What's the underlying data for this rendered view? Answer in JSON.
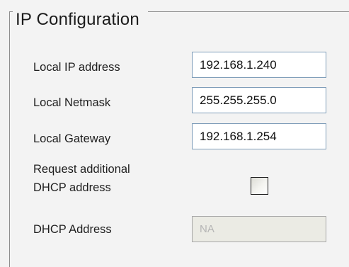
{
  "ip_configuration": {
    "title": "IP Configuration",
    "local_ip": {
      "label": "Local IP address",
      "value": "192.168.1.240"
    },
    "local_netmask": {
      "label": "Local Netmask",
      "value": "255.255.255.0"
    },
    "local_gateway": {
      "label": "Local Gateway",
      "value": "192.168.1.254"
    },
    "request_dhcp": {
      "label_line1": "Request additional",
      "label_line2": "DHCP address",
      "checked": false
    },
    "dhcp_address": {
      "label": "DHCP Address",
      "value": "NA"
    }
  }
}
